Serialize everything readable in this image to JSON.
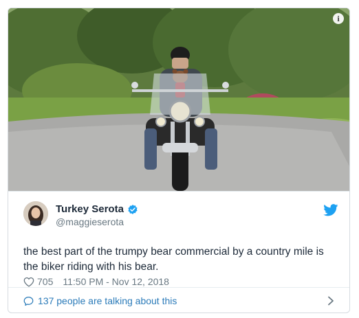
{
  "media": {
    "alt_description_icon": "info-icon",
    "info_glyph": "i"
  },
  "tweet": {
    "display_name": "Turkey Serota",
    "handle": "@maggieserota",
    "text": "the best part of the trumpy bear commercial by a country mile is the biker riding with his bear.",
    "like_count": "705",
    "timestamp": "11:50 PM - Nov 12, 2018"
  },
  "footer": {
    "conversation_text": "137 people are talking about this"
  },
  "colors": {
    "brand_blue": "#1da1f2",
    "link_blue": "#2b7bb9",
    "text_dark": "#1c2938",
    "text_gray": "#697882"
  },
  "icons": [
    "info-icon",
    "verified-badge-icon",
    "twitter-bird-icon",
    "heart-icon",
    "chat-bubble-icon",
    "chevron-right-icon"
  ]
}
